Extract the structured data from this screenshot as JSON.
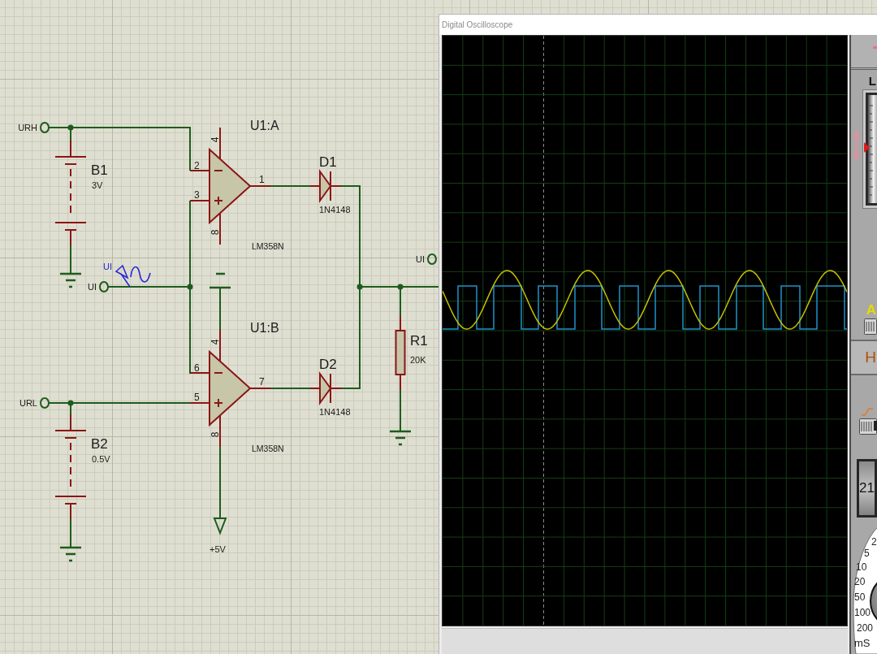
{
  "schematic": {
    "terminals": [
      {
        "label": "URH"
      },
      {
        "label": "UI"
      },
      {
        "label": "URL"
      },
      {
        "label": "UI"
      }
    ],
    "batteries": [
      {
        "ref": "B1",
        "value": "3V"
      },
      {
        "ref": "B2",
        "value": "0.5V"
      }
    ],
    "op_amps": [
      {
        "ref": "U1:A",
        "part": "LM358N",
        "pins": [
          "4",
          "2",
          "3",
          "1",
          "8"
        ]
      },
      {
        "ref": "U1:B",
        "part": "LM358N",
        "pins": [
          "4",
          "6",
          "5",
          "7",
          "8"
        ]
      }
    ],
    "diodes": [
      {
        "ref": "D1",
        "part": "1N4148"
      },
      {
        "ref": "D2",
        "part": "1N4148"
      }
    ],
    "resistor": {
      "ref": "R1",
      "value": "20K"
    },
    "generator": {
      "label": "UI"
    },
    "supply": {
      "label": "+5V"
    }
  },
  "oscilloscope": {
    "title": "Digital Oscilloscope",
    "panel": {
      "top_label": "L",
      "trace_label": "A",
      "section_label": "H",
      "display": "21",
      "dial_labels": [
        "2",
        "5",
        "10",
        "20",
        "50",
        "100",
        "200"
      ],
      "dial_unit": "mS"
    }
  }
}
